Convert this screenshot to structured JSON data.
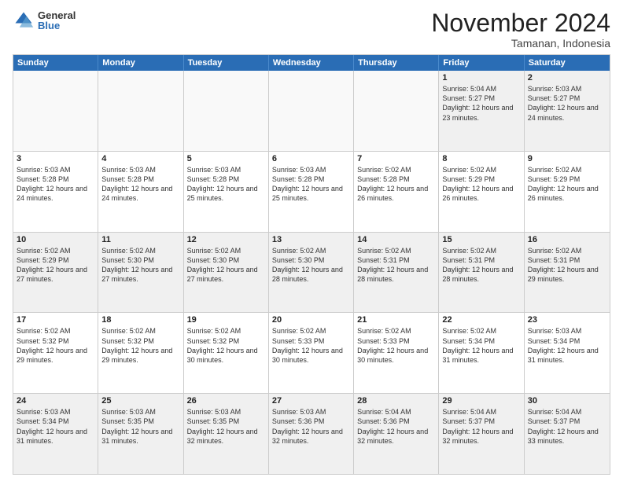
{
  "logo": {
    "general": "General",
    "blue": "Blue"
  },
  "header": {
    "month": "November 2024",
    "location": "Tamanan, Indonesia"
  },
  "weekdays": [
    "Sunday",
    "Monday",
    "Tuesday",
    "Wednesday",
    "Thursday",
    "Friday",
    "Saturday"
  ],
  "rows": [
    [
      {
        "day": "",
        "empty": true
      },
      {
        "day": "",
        "empty": true
      },
      {
        "day": "",
        "empty": true
      },
      {
        "day": "",
        "empty": true
      },
      {
        "day": "",
        "empty": true
      },
      {
        "day": "1",
        "sunrise": "5:04 AM",
        "sunset": "5:27 PM",
        "daylight": "12 hours and 23 minutes."
      },
      {
        "day": "2",
        "sunrise": "5:03 AM",
        "sunset": "5:27 PM",
        "daylight": "12 hours and 24 minutes."
      }
    ],
    [
      {
        "day": "3",
        "sunrise": "5:03 AM",
        "sunset": "5:28 PM",
        "daylight": "12 hours and 24 minutes."
      },
      {
        "day": "4",
        "sunrise": "5:03 AM",
        "sunset": "5:28 PM",
        "daylight": "12 hours and 24 minutes."
      },
      {
        "day": "5",
        "sunrise": "5:03 AM",
        "sunset": "5:28 PM",
        "daylight": "12 hours and 25 minutes."
      },
      {
        "day": "6",
        "sunrise": "5:03 AM",
        "sunset": "5:28 PM",
        "daylight": "12 hours and 25 minutes."
      },
      {
        "day": "7",
        "sunrise": "5:02 AM",
        "sunset": "5:28 PM",
        "daylight": "12 hours and 26 minutes."
      },
      {
        "day": "8",
        "sunrise": "5:02 AM",
        "sunset": "5:29 PM",
        "daylight": "12 hours and 26 minutes."
      },
      {
        "day": "9",
        "sunrise": "5:02 AM",
        "sunset": "5:29 PM",
        "daylight": "12 hours and 26 minutes."
      }
    ],
    [
      {
        "day": "10",
        "sunrise": "5:02 AM",
        "sunset": "5:29 PM",
        "daylight": "12 hours and 27 minutes."
      },
      {
        "day": "11",
        "sunrise": "5:02 AM",
        "sunset": "5:30 PM",
        "daylight": "12 hours and 27 minutes."
      },
      {
        "day": "12",
        "sunrise": "5:02 AM",
        "sunset": "5:30 PM",
        "daylight": "12 hours and 27 minutes."
      },
      {
        "day": "13",
        "sunrise": "5:02 AM",
        "sunset": "5:30 PM",
        "daylight": "12 hours and 28 minutes."
      },
      {
        "day": "14",
        "sunrise": "5:02 AM",
        "sunset": "5:31 PM",
        "daylight": "12 hours and 28 minutes."
      },
      {
        "day": "15",
        "sunrise": "5:02 AM",
        "sunset": "5:31 PM",
        "daylight": "12 hours and 28 minutes."
      },
      {
        "day": "16",
        "sunrise": "5:02 AM",
        "sunset": "5:31 PM",
        "daylight": "12 hours and 29 minutes."
      }
    ],
    [
      {
        "day": "17",
        "sunrise": "5:02 AM",
        "sunset": "5:32 PM",
        "daylight": "12 hours and 29 minutes."
      },
      {
        "day": "18",
        "sunrise": "5:02 AM",
        "sunset": "5:32 PM",
        "daylight": "12 hours and 29 minutes."
      },
      {
        "day": "19",
        "sunrise": "5:02 AM",
        "sunset": "5:32 PM",
        "daylight": "12 hours and 30 minutes."
      },
      {
        "day": "20",
        "sunrise": "5:02 AM",
        "sunset": "5:33 PM",
        "daylight": "12 hours and 30 minutes."
      },
      {
        "day": "21",
        "sunrise": "5:02 AM",
        "sunset": "5:33 PM",
        "daylight": "12 hours and 30 minutes."
      },
      {
        "day": "22",
        "sunrise": "5:02 AM",
        "sunset": "5:34 PM",
        "daylight": "12 hours and 31 minutes."
      },
      {
        "day": "23",
        "sunrise": "5:03 AM",
        "sunset": "5:34 PM",
        "daylight": "12 hours and 31 minutes."
      }
    ],
    [
      {
        "day": "24",
        "sunrise": "5:03 AM",
        "sunset": "5:34 PM",
        "daylight": "12 hours and 31 minutes."
      },
      {
        "day": "25",
        "sunrise": "5:03 AM",
        "sunset": "5:35 PM",
        "daylight": "12 hours and 31 minutes."
      },
      {
        "day": "26",
        "sunrise": "5:03 AM",
        "sunset": "5:35 PM",
        "daylight": "12 hours and 32 minutes."
      },
      {
        "day": "27",
        "sunrise": "5:03 AM",
        "sunset": "5:36 PM",
        "daylight": "12 hours and 32 minutes."
      },
      {
        "day": "28",
        "sunrise": "5:04 AM",
        "sunset": "5:36 PM",
        "daylight": "12 hours and 32 minutes."
      },
      {
        "day": "29",
        "sunrise": "5:04 AM",
        "sunset": "5:37 PM",
        "daylight": "12 hours and 32 minutes."
      },
      {
        "day": "30",
        "sunrise": "5:04 AM",
        "sunset": "5:37 PM",
        "daylight": "12 hours and 33 minutes."
      }
    ]
  ],
  "labels": {
    "sunrise": "Sunrise:",
    "sunset": "Sunset:",
    "daylight": "Daylight:"
  }
}
